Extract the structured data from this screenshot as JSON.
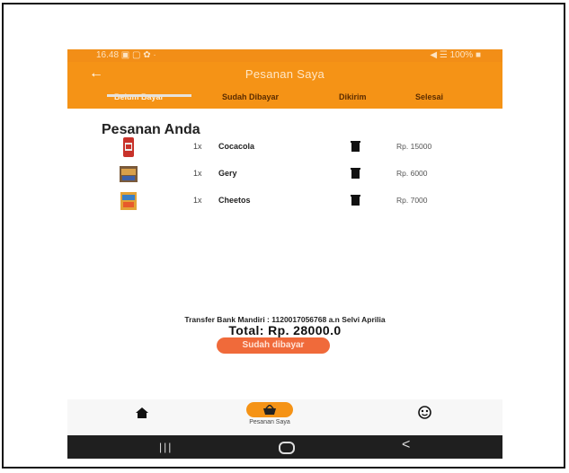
{
  "status_bar": {
    "time_and_icons": "16.48 ▣ ▢ ✿ ·",
    "right_text": "◀ ☰ 100% ■"
  },
  "app_bar": {
    "back_icon": "arrow-left-icon",
    "title": "Pesanan Saya"
  },
  "tabs": [
    {
      "label": "Belum Bayar",
      "active": true
    },
    {
      "label": "Sudah Dibayar",
      "active": false
    },
    {
      "label": "Dikirim",
      "active": false
    },
    {
      "label": "Selesai",
      "active": false
    }
  ],
  "heading": "Pesanan Anda",
  "orders": [
    {
      "qty": "1x",
      "name": "Cocacola",
      "price": "Rp. 15000",
      "thumb_color": "#c8322a"
    },
    {
      "qty": "1x",
      "name": "Gery",
      "price": "Rp. 6000",
      "thumb_color": "#c98a3a"
    },
    {
      "qty": "1x",
      "name": "Cheetos",
      "price": "Rp. 7000",
      "thumb_color": "#e4a235"
    }
  ],
  "payment": {
    "transfer_text": "Transfer Bank Mandiri : 1120017056768 a.n Selvi Aprilia",
    "total": "Total: Rp. 28000.0",
    "button_label": "Sudah dibayar"
  },
  "bottom_nav": {
    "center_label": "Pesanan Saya",
    "icons": [
      "home-icon",
      "basket-icon",
      "emoji-icon"
    ]
  },
  "system_nav": {
    "recent": "|||",
    "back": "<"
  },
  "colors": {
    "primary": "#f59316",
    "button": "#f06a3a"
  }
}
